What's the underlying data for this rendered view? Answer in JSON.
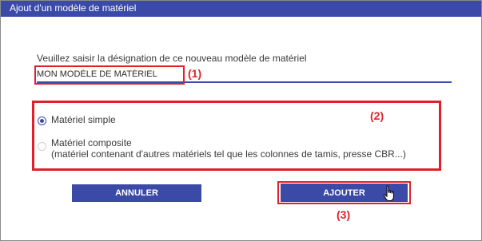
{
  "dialog": {
    "title": "Ajout d'un modèle de matériel",
    "field_label": "Veuillez saisir la désignation de ce nouveau modèle de matériel",
    "field_value": "MON MODÈLE DE MATÉRIEL",
    "options": [
      {
        "label": "Matériel simple",
        "checked": true
      },
      {
        "label": "Matériel composite",
        "sublabel": "(matériel contenant d'autres matériels tel que les colonnes de tamis, presse CBR...)",
        "checked": false
      }
    ],
    "buttons": {
      "cancel": "ANNULER",
      "add": "AJOUTER"
    }
  },
  "annotations": {
    "m1": "(1)",
    "m2": "(2)",
    "m3": "(3)"
  },
  "colors": {
    "accent": "#3b4aa6",
    "highlight": "#e0212c"
  },
  "icons": {
    "cursor": "hand-pointer-icon"
  }
}
